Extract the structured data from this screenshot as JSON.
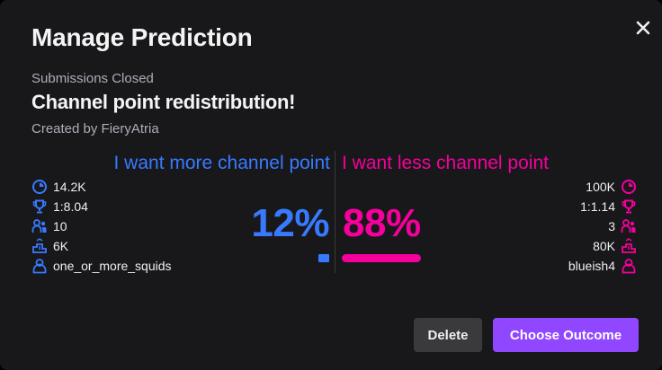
{
  "modal": {
    "title": "Manage Prediction",
    "status": "Submissions Closed",
    "question": "Channel point redistribution!",
    "creator": "Created by FieryAtria"
  },
  "colors": {
    "blue": "#387aff",
    "pink": "#f5009b",
    "primary_button": "#9147ff",
    "secondary_button": "#3a3a3d",
    "background": "#18181b"
  },
  "outcomes": [
    {
      "title": "I want more channel point",
      "percent": "12%",
      "share": 0.12,
      "color": "blue",
      "stats": {
        "points": "14.2K",
        "ratio": "1:8.04",
        "users": "10",
        "top_bet": "6K",
        "top_user": "one_or_more_squids"
      },
      "icons": [
        "clock-icon",
        "trophy-icon",
        "users-icon",
        "podium-icon",
        "user-icon"
      ]
    },
    {
      "title": "I want less channel point",
      "percent": "88%",
      "share": 0.88,
      "color": "pink",
      "stats": {
        "points": "100K",
        "ratio": "1:1.14",
        "users": "3",
        "top_bet": "80K",
        "top_user": "blueish4"
      },
      "icons": [
        "clock-icon",
        "trophy-icon",
        "users-icon",
        "podium-icon",
        "user-icon"
      ]
    }
  ],
  "actions": {
    "delete_label": "Delete",
    "choose_label": "Choose Outcome"
  },
  "close_icon": "close-icon"
}
